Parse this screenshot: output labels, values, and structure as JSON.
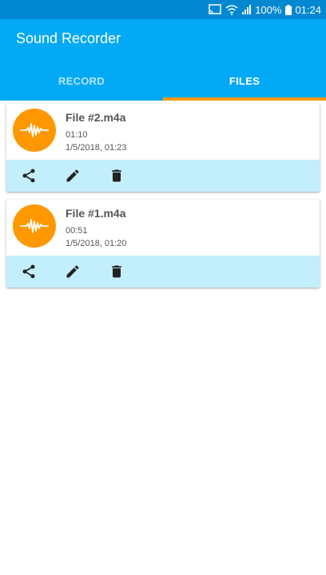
{
  "status_bar": {
    "battery": "100%",
    "time": "01:24",
    "icons": [
      "cast-icon",
      "wifi-icon",
      "signal-icon",
      "battery-icon"
    ]
  },
  "app": {
    "title": "Sound Recorder"
  },
  "tabs": [
    {
      "label": "RECORD",
      "active": false
    },
    {
      "label": "FILES",
      "active": true
    }
  ],
  "colors": {
    "primary": "#03a9f4",
    "primary_dark": "#0288d1",
    "accent": "#ff9800",
    "action_bar": "#c3eefc"
  },
  "files": [
    {
      "name": "File #2.m4a",
      "duration": "01:10",
      "date": "1/5/2018, 01:23",
      "icon": "waveform-icon"
    },
    {
      "name": "File #1.m4a",
      "duration": "00:51",
      "date": "1/5/2018, 01:20",
      "icon": "waveform-icon"
    }
  ],
  "file_actions": [
    "share-icon",
    "edit-icon",
    "delete-icon"
  ]
}
